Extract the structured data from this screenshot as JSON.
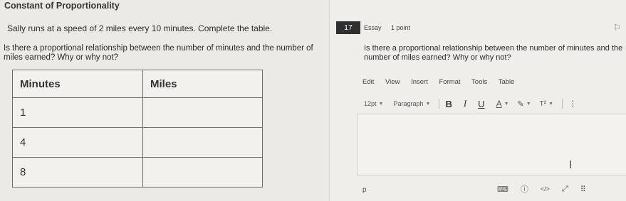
{
  "left": {
    "title": "Constant of Proportionality",
    "prompt": "Sally runs at a speed of 2 miles every 10 minutes. Complete the table.",
    "question": "Is there a proportional relationship between the number of minutes and the number of miles earned? Why or why not?",
    "table": {
      "headers": [
        "Minutes",
        "Miles"
      ],
      "rows": [
        [
          "1",
          ""
        ],
        [
          "4",
          ""
        ],
        [
          "8",
          ""
        ]
      ]
    }
  },
  "right": {
    "number": "17",
    "type": "Essay",
    "points": "1 point",
    "question": "Is there a proportional relationship between the number of minutes and the\nnumber of miles earned? Why or why not?",
    "menu": [
      "Edit",
      "View",
      "Insert",
      "Format",
      "Tools",
      "Table"
    ],
    "toolbar": {
      "font_size": "12pt",
      "block_format": "Paragraph",
      "bold": "B",
      "italic": "I",
      "underline": "U",
      "text_color": "A",
      "highlight": "✎",
      "superscript": "T²",
      "more": "⋮"
    },
    "editor_text": "",
    "status_path": "p",
    "status_icons": {
      "keyboard": "⌨",
      "accessibility": "ⓘ",
      "html": "</>",
      "expand": "⤢",
      "grip": "⠿"
    }
  }
}
